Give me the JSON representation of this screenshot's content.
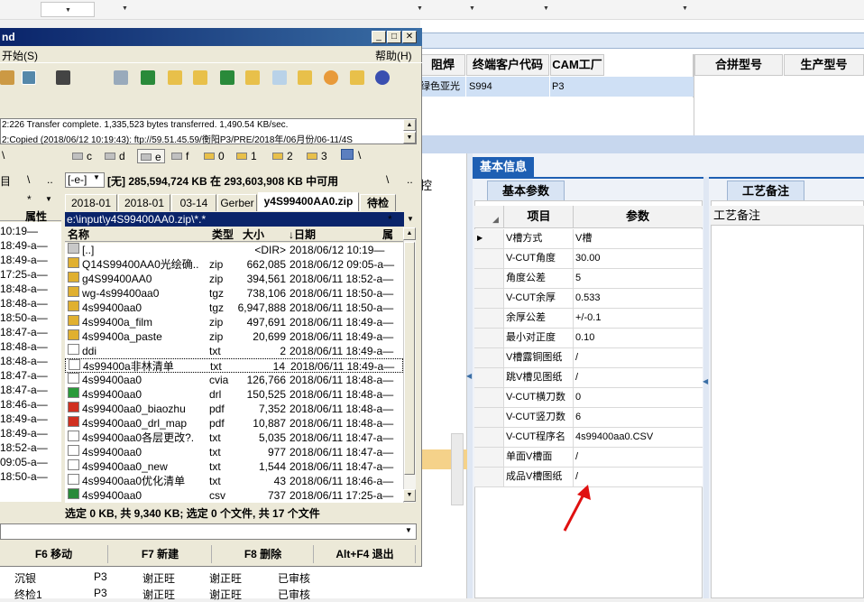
{
  "bg_app": {
    "grid_headers": [
      "阻焊",
      "终端客户代码",
      "CAM工厂",
      "合拼型号",
      "生产型号"
    ],
    "grid_row": {
      "solder": "绿色亚光",
      "customer": "S994",
      "factory": "P3"
    },
    "side_label": "控",
    "info_tab": "基本信息",
    "params_tab": "基本参数",
    "process_tab": "工艺备注",
    "process_col": "工艺备注",
    "param_headers": [
      "项目",
      "参数"
    ],
    "params": [
      {
        "k": "V槽方式",
        "v": "V槽"
      },
      {
        "k": "V-CUT角度",
        "v": "30.00"
      },
      {
        "k": "角度公差",
        "v": "5"
      },
      {
        "k": "V-CUT余厚",
        "v": "0.533"
      },
      {
        "k": "余厚公差",
        "v": "+/-0.1"
      },
      {
        "k": "最小对正度",
        "v": "0.10"
      },
      {
        "k": "V槽露铜图纸",
        "v": "/"
      },
      {
        "k": "跳V槽见图纸",
        "v": "/"
      },
      {
        "k": "V-CUT横刀数",
        "v": "0"
      },
      {
        "k": "V-CUT竖刀数",
        "v": "6"
      },
      {
        "k": "V-CUT程序名",
        "v": "4s99400aa0.CSV"
      },
      {
        "k": "单面V槽面",
        "v": "/"
      },
      {
        "k": "成品V槽图纸",
        "v": "/"
      }
    ],
    "bottom_rows": [
      {
        "name": "沉银",
        "factory": "P3",
        "a": "谢正旺",
        "b": "谢正旺",
        "status": "已审核"
      },
      {
        "name": "终检1",
        "factory": "P3",
        "a": "谢正旺",
        "b": "谢正旺",
        "status": "已审核"
      }
    ],
    "accent_color": "#1e5fb3",
    "arrow_color": "#e01010"
  },
  "tc": {
    "title": "nd",
    "menu_start": "开始(S)",
    "menu_help": "帮助(H)",
    "log": [
      "2:226 Transfer complete. 1,335,523 bytes transferred. 1,490.54 KB/sec.",
      "2:Copied (2018/06/12 10:19:43): ftp://59.51.45.59/衡阳P3/PRE/2018年/06月份/06-11/4S"
    ],
    "drives": [
      "c",
      "d",
      "e",
      "f",
      "0",
      "1",
      "2",
      "3"
    ],
    "drive_left_sym": "\\",
    "drive_right_sym": "\\",
    "left_label": "目",
    "drive_combo": "[-e-]",
    "free_space": "[无] 285,594,724 KB 在 293,603,908 KB 中可用",
    "tabs": [
      "2018-01",
      "2018-01",
      "03-14",
      "Gerber",
      "y4S99400AA0.zip",
      "待检"
    ],
    "path": "e:\\input\\y4S99400AA0.zip\\*.*",
    "col_headers": {
      "name": "名称",
      "type": "类型",
      "size": "大小",
      "date": "↓日期",
      "attr": "属性"
    },
    "left_attr_header": "属性",
    "left_times": [
      "10:19—",
      "18:49-a—",
      "18:49-a—",
      "17:25-a—",
      "18:48-a—",
      "18:48-a—",
      "18:50-a—",
      "18:47-a—",
      "18:48-a—",
      "18:48-a—",
      "18:47-a—",
      "18:47-a—",
      "18:46-a—",
      "18:49-a—",
      "18:49-a—",
      "18:52-a—",
      "09:05-a—",
      "18:50-a—"
    ],
    "files": [
      {
        "name": "[..]",
        "type": "",
        "size": "<DIR>",
        "date": "2018/06/12 10:19—",
        "icon": "up"
      },
      {
        "name": "Q14S99400AA0光绘确..",
        "type": "zip",
        "size": "662,085",
        "date": "2018/06/12 09:05-a—",
        "icon": "zip"
      },
      {
        "name": "g4S99400AA0",
        "type": "zip",
        "size": "394,561",
        "date": "2018/06/11 18:52-a—",
        "icon": "zip"
      },
      {
        "name": "wg-4s99400aa0",
        "type": "tgz",
        "size": "738,106",
        "date": "2018/06/11 18:50-a—",
        "icon": "zip"
      },
      {
        "name": "4s99400aa0",
        "type": "tgz",
        "size": "6,947,888",
        "date": "2018/06/11 18:50-a—",
        "icon": "zip"
      },
      {
        "name": "4s99400a_film",
        "type": "zip",
        "size": "497,691",
        "date": "2018/06/11 18:49-a—",
        "icon": "zip"
      },
      {
        "name": "4s99400a_paste",
        "type": "zip",
        "size": "20,699",
        "date": "2018/06/11 18:49-a—",
        "icon": "zip"
      },
      {
        "name": "ddi",
        "type": "txt",
        "size": "2",
        "date": "2018/06/11 18:49-a—",
        "icon": "doc"
      },
      {
        "name": "4s99400a非林清单",
        "type": "txt",
        "size": "14",
        "date": "2018/06/11 18:49-a—",
        "icon": "doc"
      },
      {
        "name": "4s99400aa0",
        "type": "cvia",
        "size": "126,766",
        "date": "2018/06/11 18:48-a—",
        "icon": "doc"
      },
      {
        "name": "4s99400aa0",
        "type": "drl",
        "size": "150,525",
        "date": "2018/06/11 18:48-a—",
        "icon": "drl"
      },
      {
        "name": "4s99400aa0_biaozhu",
        "type": "pdf",
        "size": "7,352",
        "date": "2018/06/11 18:48-a—",
        "icon": "pdf"
      },
      {
        "name": "4s99400aa0_drl_map",
        "type": "pdf",
        "size": "10,887",
        "date": "2018/06/11 18:48-a—",
        "icon": "pdf"
      },
      {
        "name": "4s99400aa0各层更改?.",
        "type": "txt",
        "size": "5,035",
        "date": "2018/06/11 18:47-a—",
        "icon": "doc"
      },
      {
        "name": "4s99400aa0",
        "type": "txt",
        "size": "977",
        "date": "2018/06/11 18:47-a—",
        "icon": "doc"
      },
      {
        "name": "4s99400aa0_new",
        "type": "txt",
        "size": "1,544",
        "date": "2018/06/11 18:47-a—",
        "icon": "doc"
      },
      {
        "name": "4s99400aa0优化清单",
        "type": "txt",
        "size": "43",
        "date": "2018/06/11 18:46-a—",
        "icon": "doc"
      },
      {
        "name": "4s99400aa0",
        "type": "csv",
        "size": "737",
        "date": "2018/06/11 17:25-a—",
        "icon": "csv"
      }
    ],
    "status": "选定 0 KB, 共 9,340 KB; 选定 0 个文件, 共 17 个文件",
    "fkeys": [
      "F6 移动",
      "F7 新建",
      "F8 删除",
      "Alt+F4 退出"
    ]
  }
}
